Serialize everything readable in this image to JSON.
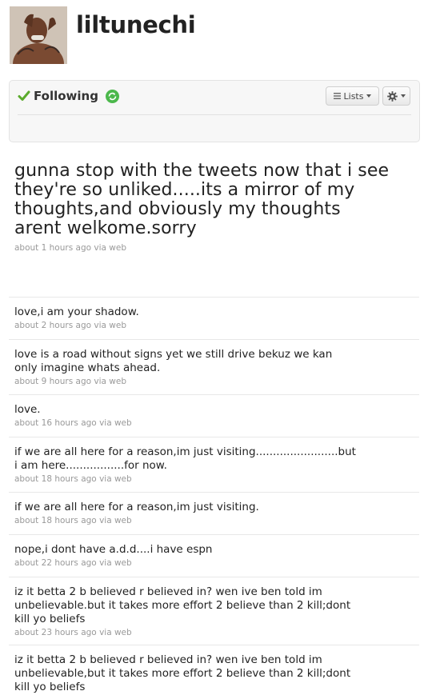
{
  "profile": {
    "username": "liltunechi"
  },
  "follow_box": {
    "status_label": "Following",
    "lists_label": "Lists"
  },
  "featured_tweet": {
    "text": "gunna stop with the tweets now that i see they're so unliked.....its a mirror of my thoughts,and obviously my thoughts arent welkome.sorry",
    "time": "about 1 hours ago",
    "source": "via web"
  },
  "tweets": [
    {
      "text": "love,i am your shadow.",
      "time": "about 2 hours ago",
      "source": "via web"
    },
    {
      "text": "love is a road without signs yet we still drive bekuz we kan only imagine whats ahead.",
      "time": "about 9 hours ago",
      "source": "via web"
    },
    {
      "text": "love.",
      "time": "about 16 hours ago",
      "source": "via web"
    },
    {
      "text": "if we are all here for a reason,im just visiting........................but i am here.................for now.",
      "time": "about 18 hours ago",
      "source": "via web"
    },
    {
      "text": "if we are all here for a reason,im just visiting.",
      "time": "about 18 hours ago",
      "source": "via web"
    },
    {
      "text": "nope,i dont have a.d.d....i have espn",
      "time": "about 22 hours ago",
      "source": "via web"
    },
    {
      "text": "iz it betta 2 b believed r believed in? wen ive ben told im unbelievable.but it takes more effort 2 believe than 2 kill;dont kill yo beliefs",
      "time": "about 23 hours ago",
      "source": "via web"
    },
    {
      "text": "iz it betta 2 b believed r believed in? wen ive ben told im unbelievable,but it takes more effort 2 believe than 2 kill;dont kill yo beliefs",
      "time": "",
      "source": ""
    }
  ],
  "colors": {
    "check_green": "#5bab2c",
    "refresh_green": "#4cb84c",
    "meta_gray": "#999999"
  },
  "icons": [
    "avatar-photo",
    "check-icon",
    "refresh-icon",
    "list-icon",
    "gear-icon",
    "caret-down-icon"
  ]
}
